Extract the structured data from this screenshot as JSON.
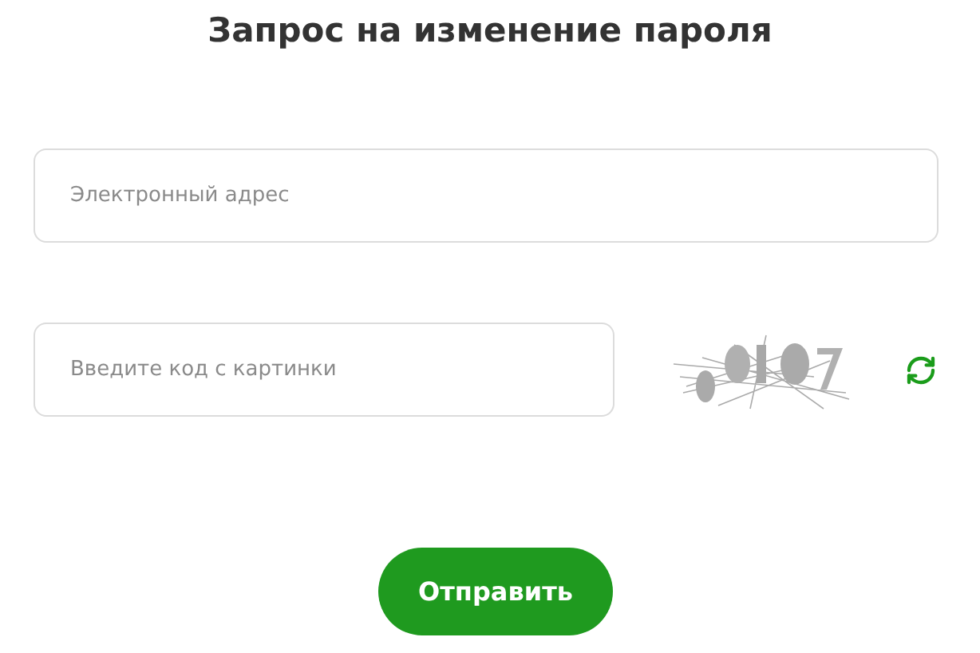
{
  "title": "Запрос на изменение пароля",
  "email_field": {
    "placeholder": "Электронный адрес"
  },
  "captcha_field": {
    "placeholder": "Введите код с картинки"
  },
  "submit_button": {
    "label": "Отправить"
  }
}
